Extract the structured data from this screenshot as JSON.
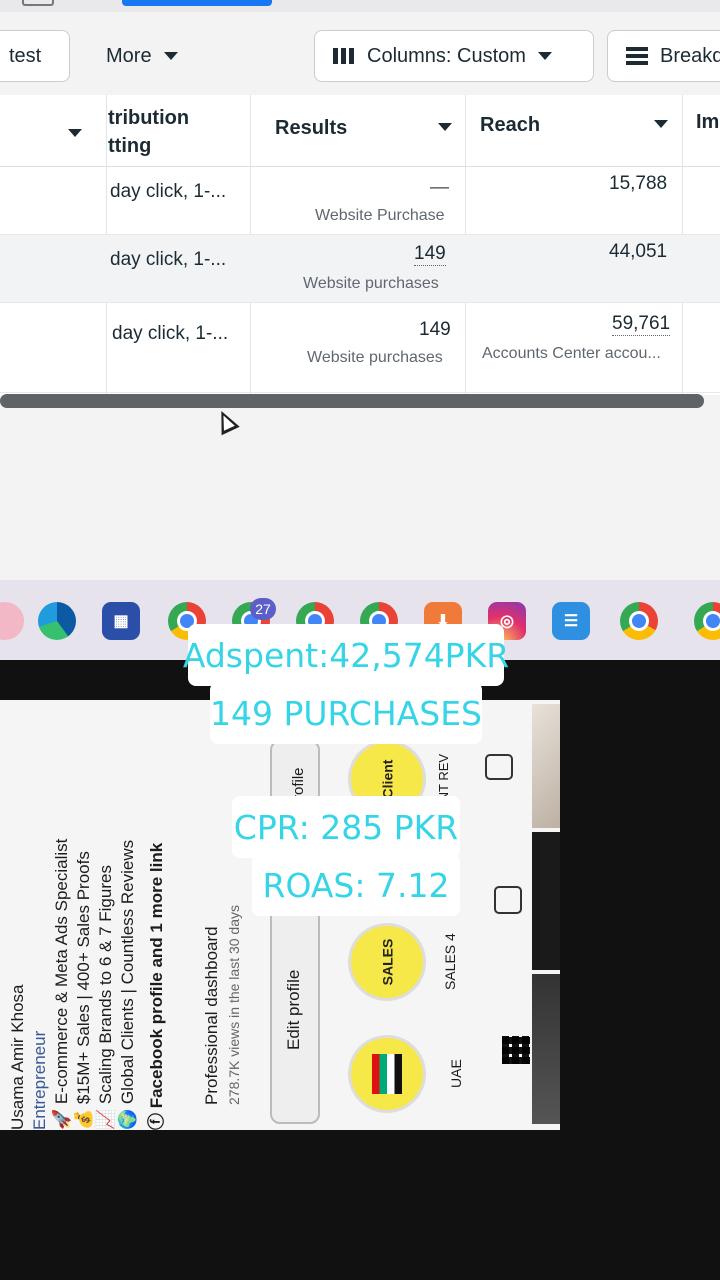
{
  "toolbar": {
    "ab_test_label": "test",
    "more_label": "More",
    "columns_label": "Columns: Custom",
    "breakdown_label": "Breakd"
  },
  "table": {
    "headers": {
      "attribution_line1": "tribution",
      "attribution_line2": "tting",
      "results": "Results",
      "reach": "Reach",
      "impressions": "Im"
    },
    "rows": [
      {
        "attribution": "day click, 1-...",
        "results_value": "—",
        "results_type": "Website Purchase",
        "reach": "15,788",
        "reach_sub": ""
      },
      {
        "attribution": "day click, 1-...",
        "results_value": "149",
        "results_type": "Website purchases",
        "reach": "44,051",
        "reach_sub": ""
      },
      {
        "attribution": "day click, 1-...",
        "results_value": "149",
        "results_type": "Website purchases",
        "reach": "59,761",
        "reach_sub": "Accounts Center accou..."
      }
    ]
  },
  "taskbar": {
    "teams_badge": "27"
  },
  "profile": {
    "name": "Usama Amir Khosa",
    "title": "Entrepreneur",
    "bio": [
      "🚀 E-commerce & Meta Ads Specialist",
      "💰 $15M+ Sales | 400+ Sales Proofs",
      "📈 Scaling Brands to 6 & 7 Figures",
      "🌍 Global Clients | Countless Reviews",
      "ⓕ Facebook profile and 1 more link"
    ],
    "dashboard_title": "Professional dashboard",
    "dashboard_sub": "278.7K views in the last 30 days",
    "edit_profile": "Edit profile",
    "share_profile": "rofile",
    "highlights": [
      {
        "label": "UAE",
        "cover": ""
      },
      {
        "label": "SALES 4",
        "cover": "SALES"
      },
      {
        "label": "ENT REV",
        "cover": "Client"
      }
    ]
  },
  "overlay": {
    "line1": "Adspent:42,574PKR",
    "line2": "149 PURCHASES",
    "line3": "CPR: 285 PKR",
    "line4": "ROAS: 7.12"
  }
}
